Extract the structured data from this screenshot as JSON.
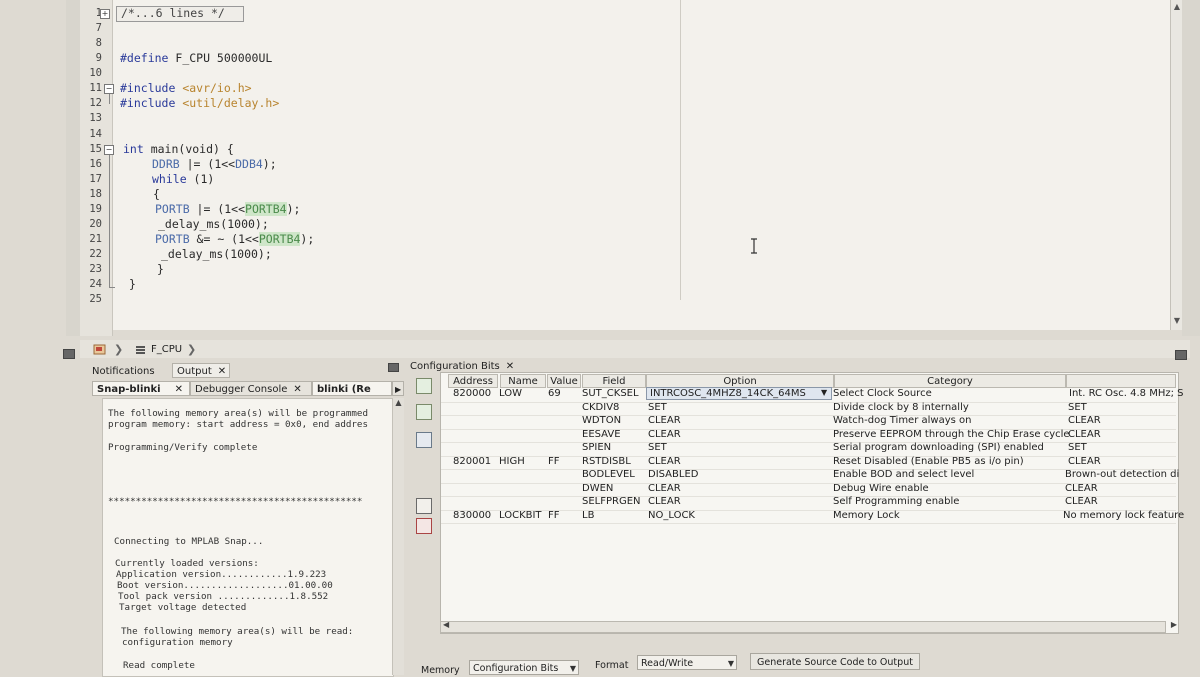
{
  "editor": {
    "folded_comment": "/*...6 lines */",
    "lines": [
      {
        "num": "1"
      },
      {
        "num": "7"
      },
      {
        "num": "8"
      },
      {
        "num": "9"
      },
      {
        "num": "10"
      },
      {
        "num": "11"
      },
      {
        "num": "12"
      },
      {
        "num": "13"
      },
      {
        "num": "14"
      },
      {
        "num": "15"
      },
      {
        "num": "16"
      },
      {
        "num": "17"
      },
      {
        "num": "18"
      },
      {
        "num": "19"
      },
      {
        "num": "20"
      },
      {
        "num": "21"
      },
      {
        "num": "22"
      },
      {
        "num": "23"
      },
      {
        "num": "24"
      },
      {
        "num": "25"
      }
    ],
    "code": {
      "define_kw": "#define",
      "define_rest": " F_CPU 500000UL",
      "inc1_kw": "#include",
      "inc1_path": " <avr/io.h>",
      "inc2_kw": "#include",
      "inc2_path": " <util/delay.h>",
      "main_type": "int",
      "main_rest": " main(void) {",
      "ddrb_reg": "DDRB",
      "ddrb_rest1": " |= (1<<",
      "ddrb_bit": "DDB4",
      "ddrb_rest2": ");",
      "while_kw": "while",
      "while_rest": " (1)",
      "open_brace": "{",
      "portb1_reg": "PORTB",
      "portb1_rest": " |= (1<<",
      "portb1_bit": "PORTB4",
      "portb1_end": ");",
      "delay1": "_delay_ms(1000);",
      "portb2_reg": "PORTB",
      "portb2_rest": " &= ~ (1<<",
      "portb2_bit": "PORTB4",
      "portb2_end": ");",
      "delay2": "_delay_ms(1000);",
      "close_brace_inner": "}",
      "close_brace_outer": "}"
    }
  },
  "breadcrumb": {
    "item": "F_CPU"
  },
  "left_panel": {
    "top_tabs": [
      {
        "label": "Notifications"
      },
      {
        "label": "Output"
      }
    ],
    "sub_tabs": [
      {
        "label": "Snap-blinki"
      },
      {
        "label": "Debugger Console"
      },
      {
        "label": "blinki (Re"
      }
    ],
    "console_lines": [
      "The following memory area(s) will be programmed",
      "program memory: start address = 0x0, end addres",
      "Programming/Verify complete",
      "**********************************************",
      "Connecting to MPLAB Snap...",
      "Currently loaded versions:",
      "Application version............1.9.223",
      "Boot version...................01.00.00",
      "Tool pack version .............1.8.552",
      "Target voltage detected",
      "The following memory area(s) will be read:",
      "configuration memory",
      "Read complete"
    ]
  },
  "config_panel": {
    "tab_label": "Configuration Bits",
    "headers": [
      "Address",
      "Name",
      "Value",
      "Field",
      "Option",
      "Category",
      ""
    ],
    "rows": [
      {
        "address": "820000",
        "name": "LOW",
        "value": "69",
        "field": "SUT_CKSEL",
        "option": "INTRCOSC_4MHZ8_14CK_64MS",
        "category": "Select Clock Source",
        "setting": "Int. RC Osc. 4.8 MHz; S"
      },
      {
        "address": "",
        "name": "",
        "value": "",
        "field": "CKDIV8",
        "option": "SET",
        "category": "Divide clock by 8 internally",
        "setting": "SET"
      },
      {
        "address": "",
        "name": "",
        "value": "",
        "field": "WDTON",
        "option": "CLEAR",
        "category": "Watch-dog Timer always on",
        "setting": "CLEAR"
      },
      {
        "address": "",
        "name": "",
        "value": "",
        "field": "EESAVE",
        "option": "CLEAR",
        "category": "Preserve EEPROM through the Chip Erase cycle",
        "setting": "CLEAR"
      },
      {
        "address": "",
        "name": "",
        "value": "",
        "field": "SPIEN",
        "option": "SET",
        "category": "Serial program downloading (SPI) enabled",
        "setting": "SET"
      },
      {
        "address": "820001",
        "name": "HIGH",
        "value": "FF",
        "field": "RSTDISBL",
        "option": "CLEAR",
        "category": "Reset Disabled (Enable PB5 as i/o pin)",
        "setting": "CLEAR"
      },
      {
        "address": "",
        "name": "",
        "value": "",
        "field": "BODLEVEL",
        "option": "DISABLED",
        "category": "Enable BOD and select level",
        "setting": "Brown-out detection di"
      },
      {
        "address": "",
        "name": "",
        "value": "",
        "field": "DWEN",
        "option": "CLEAR",
        "category": "Debug Wire enable",
        "setting": "CLEAR"
      },
      {
        "address": "",
        "name": "",
        "value": "",
        "field": "SELFPRGEN",
        "option": "CLEAR",
        "category": "Self Programming enable",
        "setting": "CLEAR"
      },
      {
        "address": "830000",
        "name": "LOCKBIT",
        "value": "FF",
        "field": "LB",
        "option": "NO_LOCK",
        "category": "Memory Lock",
        "setting": "No memory lock feature"
      }
    ],
    "bottom": {
      "memory_label": "Memory",
      "memory_value": "Configuration Bits",
      "format_label": "Format",
      "format_value": "Read/Write",
      "generate_button": "Generate Source Code to Output"
    }
  }
}
